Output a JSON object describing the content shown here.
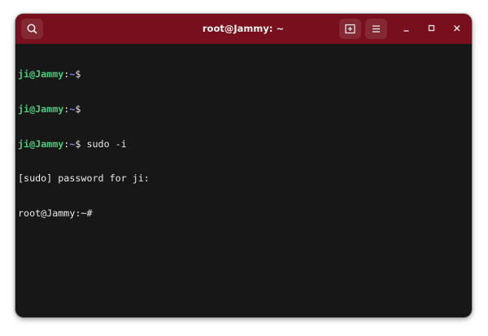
{
  "window": {
    "title": "root@Jammy: ~"
  },
  "titlebar": {
    "search_icon": "search-icon",
    "new_tab_icon": "new-tab-icon",
    "menu_icon": "hamburger-menu-icon",
    "minimize_icon": "minimize-icon",
    "maximize_icon": "maximize-icon",
    "close_icon": "close-icon"
  },
  "colors": {
    "titlebar": "#77101c",
    "terminal_bg": "#171717",
    "prompt_user": "#4fc67a",
    "prompt_path": "#6f8fd6",
    "text": "#e8e8e8"
  },
  "terminal": {
    "lines": [
      {
        "user": "ji@Jammy",
        "sep": ":",
        "path": "~",
        "symbol": "$",
        "command": ""
      },
      {
        "user": "ji@Jammy",
        "sep": ":",
        "path": "~",
        "symbol": "$",
        "command": ""
      },
      {
        "user": "ji@Jammy",
        "sep": ":",
        "path": "~",
        "symbol": "$",
        "command": " sudo -i"
      },
      {
        "text": "[sudo] password for ji:"
      },
      {
        "text": "root@Jammy:~# "
      }
    ]
  }
}
